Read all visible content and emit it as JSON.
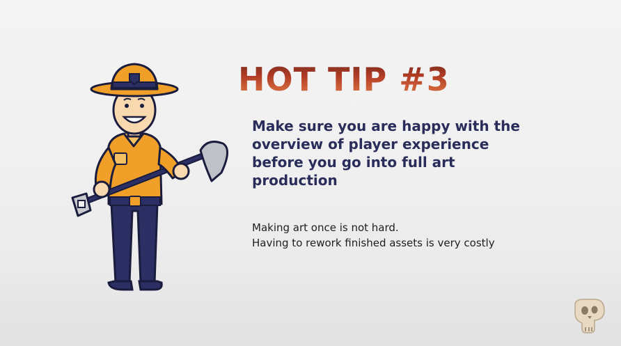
{
  "slide": {
    "title": "HOT TIP #3",
    "headline_lines": [
      "Make sure you are happy with the",
      "overview of player experience",
      "before you go into full art",
      "production"
    ],
    "body_lines": [
      "Making art once is not hard.",
      "Having to rework finished assets is very costly"
    ]
  },
  "illustration": {
    "icon": "park-ranger-with-shovel-illustration"
  },
  "branding": {
    "icon": "skull-p-logo-icon"
  },
  "colors": {
    "title_red": "#b03a24",
    "headline_navy": "#2a2d5a",
    "ranger_orange": "#f0a028",
    "ranger_navy": "#2b2f63",
    "logo_beige": "#e8d9c2"
  }
}
